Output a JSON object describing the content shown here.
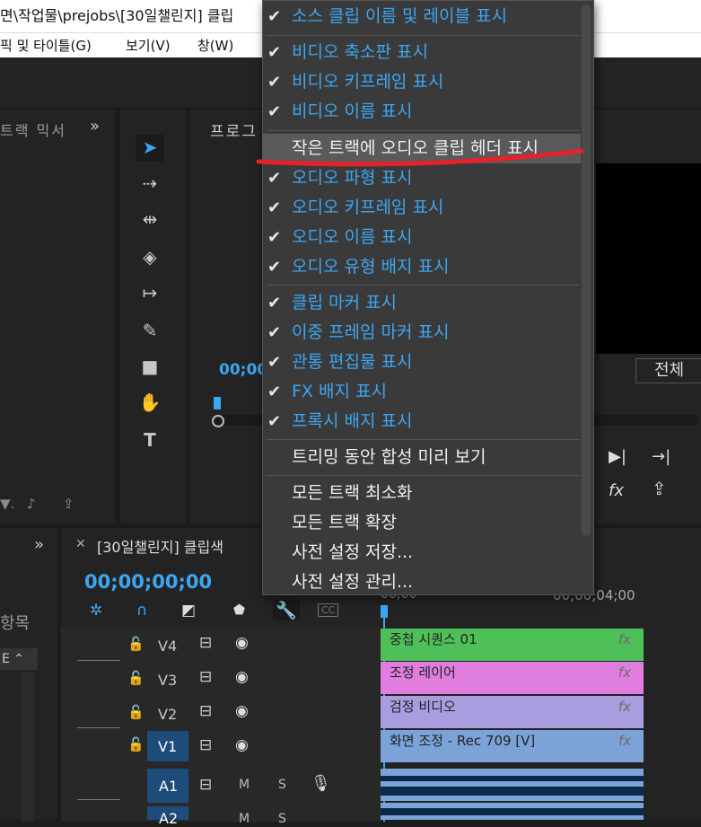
{
  "title": "면\\작업물\\prejobs\\[30일챌린지] 클립",
  "menubar": [
    "픽 및 타이틀(G)",
    "보기(V)",
    "창(W)"
  ],
  "panels": {
    "audio_mixer": "트랙 믹서",
    "program": "프로그",
    "program_timecode": "00;00",
    "zoom_fit": "전체",
    "project_items": "항목",
    "sequence_tab": "[30일챌린지] 클립색",
    "timecode": "00;00;00;00",
    "ruler_labels": [
      "00;00",
      "00;00;04;00"
    ]
  },
  "menu": {
    "items": [
      {
        "label": "소스 클립 이름 및 레이블 표시",
        "checked": true,
        "style": "blue"
      },
      {
        "label": "비디오 축소판 표시",
        "checked": true,
        "style": "blue"
      },
      {
        "label": "비디오 키프레임 표시",
        "checked": true,
        "style": "blue"
      },
      {
        "label": "비디오 이름 표시",
        "checked": true,
        "style": "blue"
      },
      {
        "label": "작은 트랙에 오디오 클립 헤더 표시",
        "checked": false,
        "style": "highlight"
      },
      {
        "label": "오디오 파형 표시",
        "checked": true,
        "style": "blue"
      },
      {
        "label": "오디오 키프레임 표시",
        "checked": true,
        "style": "blue"
      },
      {
        "label": "오디오 이름 표시",
        "checked": true,
        "style": "blue"
      },
      {
        "label": "오디오 유형 배지 표시",
        "checked": true,
        "style": "blue"
      },
      {
        "label": "클립 마커 표시",
        "checked": true,
        "style": "blue"
      },
      {
        "label": "이중 프레임 마커 표시",
        "checked": true,
        "style": "blue"
      },
      {
        "label": "관통 편집물 표시",
        "checked": true,
        "style": "blue"
      },
      {
        "label": "FX 배지 표시",
        "checked": true,
        "style": "blue"
      },
      {
        "label": "프록시 배지 표시",
        "checked": true,
        "style": "blue"
      },
      {
        "label": "트리밍 동안 합성 미리 보기",
        "checked": false,
        "style": "white"
      },
      {
        "label": "모든 트랙 최소화",
        "checked": false,
        "style": "white"
      },
      {
        "label": "모든 트랙 확장",
        "checked": false,
        "style": "white"
      },
      {
        "label": "사전 설정 저장...",
        "checked": false,
        "style": "white"
      },
      {
        "label": "사전 설정 관리...",
        "checked": false,
        "style": "white"
      }
    ]
  },
  "tracks": {
    "video": [
      "V4",
      "V3",
      "V2",
      "V1"
    ],
    "audio": [
      "A1",
      "A2"
    ],
    "audio_buttons": [
      "M",
      "S"
    ]
  },
  "clips": [
    {
      "name": "중첩 시퀀스 01",
      "color": "#4fbf5a",
      "fx": "fx"
    },
    {
      "name": "조정 레이어",
      "color": "#e07ee0",
      "fx": "fx"
    },
    {
      "name": "검정 비디오",
      "color": "#a99de0",
      "fx": "fx"
    },
    {
      "name": "화면 조정 - Rec 709 [V]",
      "color": "#7ba3d8",
      "fx": "fx"
    }
  ],
  "colors": {
    "accent": "#3da6f2",
    "annotation": "#e8202a"
  }
}
